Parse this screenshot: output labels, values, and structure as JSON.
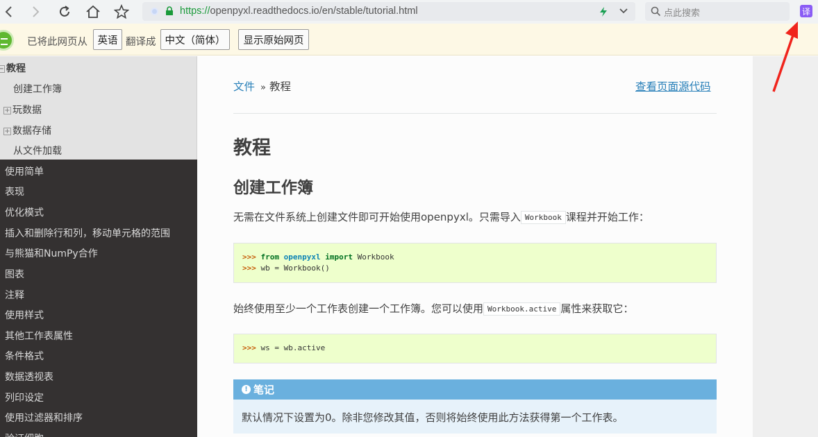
{
  "browser": {
    "url_scheme": "https://",
    "url_rest": "openpyxl.readthedocs.io/en/stable/tutorial.html",
    "search_placeholder": "点此搜索",
    "extension_label": "译"
  },
  "translate_bar": {
    "prefix": "已将此网页从",
    "source_lang": "英语",
    "middle": "翻译成",
    "target_lang": "中文（简体）",
    "show_original": "显示原始网页"
  },
  "sidebar": {
    "current_section": "教程",
    "sub_items": [
      {
        "label": "创建工作簿",
        "expandable": false
      },
      {
        "label": "玩数据",
        "expandable": true
      },
      {
        "label": "数据存储",
        "expandable": true
      },
      {
        "label": "从文件加载",
        "expandable": false
      }
    ],
    "items": [
      "使用简单",
      "表现",
      "优化模式",
      "插入和删除行和列，移动单元格的范围",
      "与熊猫和NumPy合作",
      "图表",
      "注释",
      "使用样式",
      "其他工作表属性",
      "条件格式",
      "数据透视表",
      "列印设定",
      "使用过滤器和排序",
      "验证细胞"
    ]
  },
  "breadcrumb": {
    "home": "文件",
    "separator": "»",
    "current": "教程",
    "view_source": "查看页面源代码"
  },
  "article": {
    "title": "教程",
    "section_title": "创建工作簿",
    "para1_before": "无需在文件系统上创建文件即可开始使用openpyxl。只需导入",
    "para1_code": "Workbook",
    "para1_after": "课程并开始工作：",
    "code1": {
      "line1": {
        "prompt": ">>> ",
        "kw1": "from",
        "module": "openpyxl",
        "kw2": "import",
        "name": "Workbook"
      },
      "line2": {
        "prompt": ">>> ",
        "code": "wb = Workbook()"
      }
    },
    "para2_before": "始终使用至少一个工作表创建一个工作簿。您可以使用",
    "para2_code": "Workbook.active",
    "para2_after": "属性来获取它：",
    "code2": {
      "prompt": ">>> ",
      "code": "ws = wb.active"
    },
    "note": {
      "title": "笔记",
      "icon": "!",
      "body": "默认情况下设置为0。除非您修改其值，否则将始终使用此方法获得第一个工作表。"
    }
  }
}
